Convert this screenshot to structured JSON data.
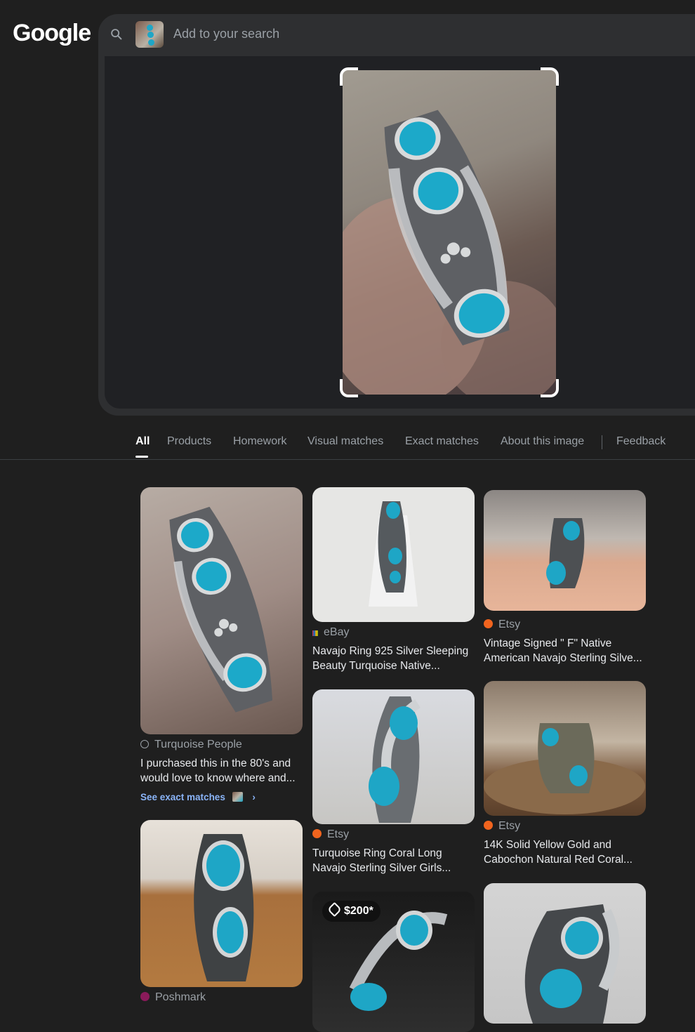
{
  "logo": "Google",
  "search": {
    "placeholder": "Add to your search",
    "icon": "search-icon"
  },
  "tabs": [
    {
      "label": "All",
      "active": true
    },
    {
      "label": "Products"
    },
    {
      "label": "Homework"
    },
    {
      "label": "Visual matches"
    },
    {
      "label": "Exact matches"
    },
    {
      "label": "About this image"
    },
    {
      "label": "Feedback"
    }
  ],
  "results": {
    "r1": {
      "source": "Turquoise People",
      "title": "I purchased this in the 80's and would love to know where and...",
      "link": "See exact matches"
    },
    "r2": {
      "source": "eBay",
      "title": "Navajo Ring 925 Silver Sleeping Beauty Turquoise Native..."
    },
    "r3": {
      "source": "Etsy",
      "title": "Vintage Signed \" F\" Native American Navajo Sterling Silve..."
    },
    "r4": {
      "source": "Etsy",
      "title": "Turquoise Ring Coral Long Navajo Sterling Silver Girls..."
    },
    "r5": {
      "source": "Etsy",
      "title": "14K Solid Yellow Gold and Cabochon Natural Red Coral..."
    },
    "r6": {
      "source": "Poshmark"
    },
    "r7": {
      "price": "$200*"
    }
  },
  "colors": {
    "background": "#1f1f1f",
    "link": "#8ab4f8",
    "etsy": "#f1641e",
    "turquoise": "#1ea6c6"
  }
}
